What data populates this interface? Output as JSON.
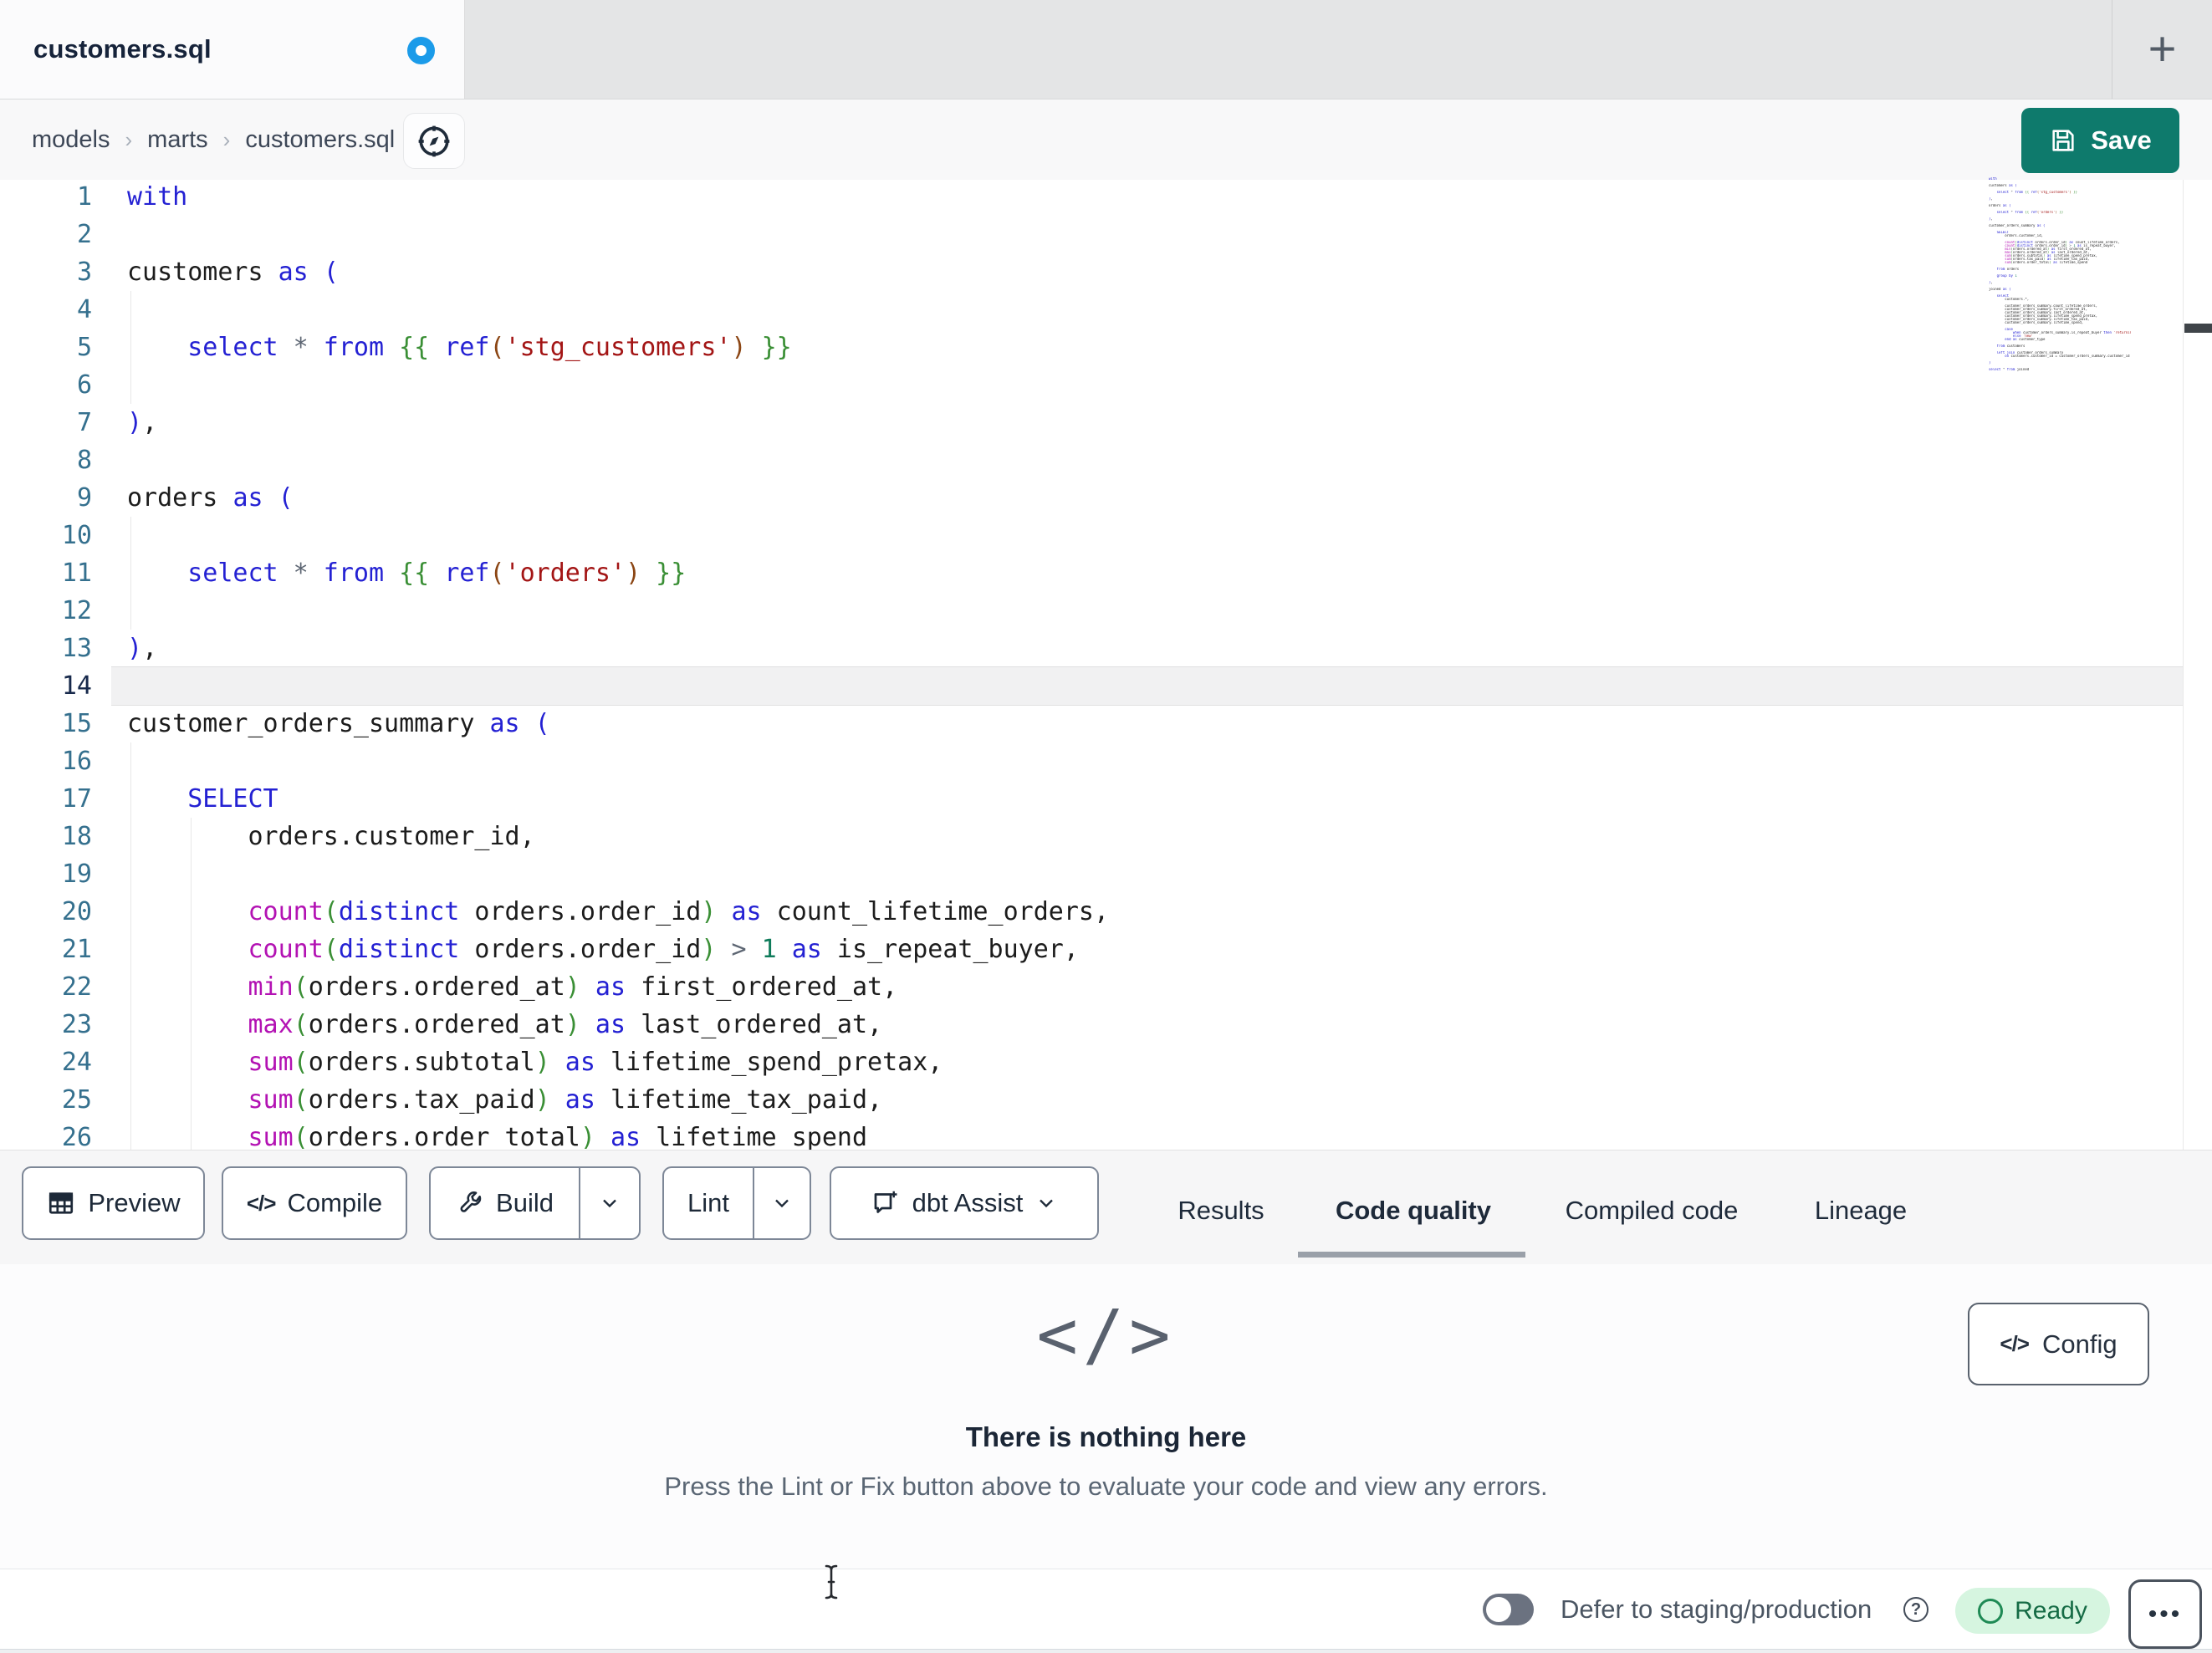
{
  "window": {
    "tab_title": "customers.sql",
    "new_tab_glyph": "+"
  },
  "breadcrumb": {
    "items": [
      "models",
      "marts",
      "customers.sql"
    ],
    "separator": "›"
  },
  "save_button": {
    "label": "Save"
  },
  "editor": {
    "active_line": 14,
    "lines": [
      {
        "n": 1,
        "tokens": [
          [
            "kw",
            "with"
          ]
        ]
      },
      {
        "n": 2,
        "tokens": []
      },
      {
        "n": 3,
        "tokens": [
          [
            "pl",
            "customers "
          ],
          [
            "kw",
            "as "
          ],
          [
            "kw",
            "("
          ]
        ]
      },
      {
        "n": 4,
        "tokens": []
      },
      {
        "n": 5,
        "tokens": [
          [
            "pl",
            "    "
          ],
          [
            "kw",
            "select"
          ],
          [
            "op",
            " *"
          ],
          [
            "kw",
            " from"
          ],
          [
            "jj",
            " {{ "
          ],
          [
            "kw",
            "ref"
          ],
          [
            "br",
            "("
          ],
          [
            "st",
            "'stg_customers'"
          ],
          [
            "br",
            ")"
          ],
          [
            "jj",
            " }}"
          ]
        ]
      },
      {
        "n": 6,
        "tokens": []
      },
      {
        "n": 7,
        "tokens": [
          [
            "kw",
            ")"
          ],
          [
            "pl",
            ","
          ]
        ]
      },
      {
        "n": 8,
        "tokens": []
      },
      {
        "n": 9,
        "tokens": [
          [
            "pl",
            "orders "
          ],
          [
            "kw",
            "as "
          ],
          [
            "kw",
            "("
          ]
        ]
      },
      {
        "n": 10,
        "tokens": []
      },
      {
        "n": 11,
        "tokens": [
          [
            "pl",
            "    "
          ],
          [
            "kw",
            "select"
          ],
          [
            "op",
            " *"
          ],
          [
            "kw",
            " from"
          ],
          [
            "jj",
            " {{ "
          ],
          [
            "kw",
            "ref"
          ],
          [
            "br",
            "("
          ],
          [
            "st",
            "'orders'"
          ],
          [
            "br",
            ")"
          ],
          [
            "jj",
            " }}"
          ]
        ]
      },
      {
        "n": 12,
        "tokens": []
      },
      {
        "n": 13,
        "tokens": [
          [
            "kw",
            ")"
          ],
          [
            "pl",
            ","
          ]
        ]
      },
      {
        "n": 14,
        "tokens": []
      },
      {
        "n": 15,
        "tokens": [
          [
            "pl",
            "customer_orders_summary "
          ],
          [
            "kw",
            "as "
          ],
          [
            "kw",
            "("
          ]
        ]
      },
      {
        "n": 16,
        "tokens": []
      },
      {
        "n": 17,
        "tokens": [
          [
            "pl",
            "    "
          ],
          [
            "kw",
            "SELECT"
          ]
        ]
      },
      {
        "n": 18,
        "tokens": [
          [
            "pl",
            "        orders.customer_id,"
          ]
        ]
      },
      {
        "n": 19,
        "tokens": []
      },
      {
        "n": 20,
        "tokens": [
          [
            "pl",
            "        "
          ],
          [
            "fn",
            "count"
          ],
          [
            "pr",
            "("
          ],
          [
            "kw",
            "distinct"
          ],
          [
            "pl",
            " orders.order_id"
          ],
          [
            "pr",
            ")"
          ],
          [
            "kw",
            " as"
          ],
          [
            "pl",
            " count_lifetime_orders,"
          ]
        ]
      },
      {
        "n": 21,
        "tokens": [
          [
            "pl",
            "        "
          ],
          [
            "fn",
            "count"
          ],
          [
            "pr",
            "("
          ],
          [
            "kw",
            "distinct"
          ],
          [
            "pl",
            " orders.order_id"
          ],
          [
            "pr",
            ")"
          ],
          [
            "op",
            " >"
          ],
          [
            "nu",
            " 1"
          ],
          [
            "kw",
            " as"
          ],
          [
            "pl",
            " is_repeat_buyer,"
          ]
        ]
      },
      {
        "n": 22,
        "tokens": [
          [
            "pl",
            "        "
          ],
          [
            "fn",
            "min"
          ],
          [
            "pr",
            "("
          ],
          [
            "pl",
            "orders.ordered_at"
          ],
          [
            "pr",
            ")"
          ],
          [
            "kw",
            " as"
          ],
          [
            "pl",
            " first_ordered_at,"
          ]
        ]
      },
      {
        "n": 23,
        "tokens": [
          [
            "pl",
            "        "
          ],
          [
            "fn",
            "max"
          ],
          [
            "pr",
            "("
          ],
          [
            "pl",
            "orders.ordered_at"
          ],
          [
            "pr",
            ")"
          ],
          [
            "kw",
            " as"
          ],
          [
            "pl",
            " last_ordered_at,"
          ]
        ]
      },
      {
        "n": 24,
        "tokens": [
          [
            "pl",
            "        "
          ],
          [
            "fn",
            "sum"
          ],
          [
            "pr",
            "("
          ],
          [
            "pl",
            "orders.subtotal"
          ],
          [
            "pr",
            ")"
          ],
          [
            "kw",
            " as"
          ],
          [
            "pl",
            " lifetime_spend_pretax,"
          ]
        ]
      },
      {
        "n": 25,
        "tokens": [
          [
            "pl",
            "        "
          ],
          [
            "fn",
            "sum"
          ],
          [
            "pr",
            "("
          ],
          [
            "pl",
            "orders.tax_paid"
          ],
          [
            "pr",
            ")"
          ],
          [
            "kw",
            " as"
          ],
          [
            "pl",
            " lifetime_tax_paid,"
          ]
        ]
      },
      {
        "n": 26,
        "tokens": [
          [
            "pl",
            "        "
          ],
          [
            "fn",
            "sum"
          ],
          [
            "pr",
            "("
          ],
          [
            "pl",
            "orders.order_total"
          ],
          [
            "pr",
            ")"
          ],
          [
            "kw",
            " as"
          ],
          [
            "pl",
            " lifetime_spend"
          ]
        ]
      }
    ],
    "minimap_extra": [
      [],
      [
        [
          "pl",
          "    "
        ],
        [
          "kw",
          "from"
        ],
        [
          "pl",
          " orders"
        ]
      ],
      [],
      [
        [
          "pl",
          "    "
        ],
        [
          "kw",
          "group by"
        ],
        [
          "nu",
          " 1"
        ]
      ],
      [],
      [
        [
          "kw",
          ")"
        ],
        [
          "pl",
          ","
        ]
      ],
      [],
      [
        [
          "pl",
          "joined "
        ],
        [
          "kw",
          "as "
        ],
        [
          "kw",
          "("
        ]
      ],
      [],
      [
        [
          "pl",
          "    "
        ],
        [
          "kw",
          "select"
        ]
      ],
      [
        [
          "pl",
          "        customers.*,"
        ]
      ],
      [],
      [
        [
          "pl",
          "        customer_orders_summary.count_lifetime_orders,"
        ]
      ],
      [
        [
          "pl",
          "        customer_orders_summary.first_ordered_at,"
        ]
      ],
      [
        [
          "pl",
          "        customer_orders_summary.last_ordered_at,"
        ]
      ],
      [
        [
          "pl",
          "        customer_orders_summary.lifetime_spend_pretax,"
        ]
      ],
      [
        [
          "pl",
          "        customer_orders_summary.lifetime_tax_paid,"
        ]
      ],
      [
        [
          "pl",
          "        customer_orders_summary.lifetime_spend,"
        ]
      ],
      [],
      [
        [
          "pl",
          "        "
        ],
        [
          "kw",
          "case"
        ]
      ],
      [
        [
          "pl",
          "            "
        ],
        [
          "kw",
          "when"
        ],
        [
          "pl",
          " customer_orders_summary.is_repeat_buyer "
        ],
        [
          "kw",
          "then"
        ],
        [
          "st",
          " 'returning'"
        ]
      ],
      [
        [
          "pl",
          "            "
        ],
        [
          "kw",
          "else"
        ],
        [
          "st",
          " 'new'"
        ]
      ],
      [
        [
          "pl",
          "        "
        ],
        [
          "kw",
          "end as"
        ],
        [
          "pl",
          " customer_type"
        ]
      ],
      [],
      [
        [
          "pl",
          "    "
        ],
        [
          "kw",
          "from"
        ],
        [
          "pl",
          " customers"
        ]
      ],
      [],
      [
        [
          "pl",
          "    "
        ],
        [
          "kw",
          "left join"
        ],
        [
          "pl",
          " customer_orders_summary"
        ]
      ],
      [
        [
          "pl",
          "        "
        ],
        [
          "kw",
          "on"
        ],
        [
          "pl",
          " customers.customer_id = customer_orders_summary.customer_id"
        ]
      ],
      [],
      [
        [
          "kw",
          ")"
        ]
      ],
      [],
      [
        [
          "kw",
          "select"
        ],
        [
          "op",
          " *"
        ],
        [
          "kw",
          " from"
        ],
        [
          "pl",
          " joined"
        ]
      ]
    ]
  },
  "toolbar": {
    "buttons": [
      {
        "label": "Preview"
      },
      {
        "label": "Compile"
      },
      {
        "label": "Build"
      },
      {
        "label": "Lint"
      },
      {
        "label": "dbt Assist"
      }
    ],
    "code_glyph": "</>"
  },
  "panel_tabs": [
    {
      "label": "Results",
      "active": false
    },
    {
      "label": "Code quality",
      "active": true
    },
    {
      "label": "Compiled code",
      "active": false
    },
    {
      "label": "Lineage",
      "active": false
    }
  ],
  "results_panel": {
    "empty_icon_glyph": "</>",
    "title": "There is nothing here",
    "subtitle": "Press the Lint or Fix button above to evaluate your code and view any errors.",
    "config_label": "Config",
    "config_glyph": "</>"
  },
  "statusbar": {
    "defer_label": "Defer to staging/production",
    "help_glyph": "?",
    "ready_label": "Ready",
    "more_glyph": "•••"
  },
  "colors": {
    "save_teal": "#0e7a6c",
    "dirty_dot_blue": "#1b9be9",
    "ready_bg": "#d6f5e0",
    "ready_text": "#156b45",
    "keyword_blue": "#2421d3",
    "function_magenta": "#b312b3",
    "string_red": "#a31515",
    "jinja_green": "#3a8f35"
  }
}
